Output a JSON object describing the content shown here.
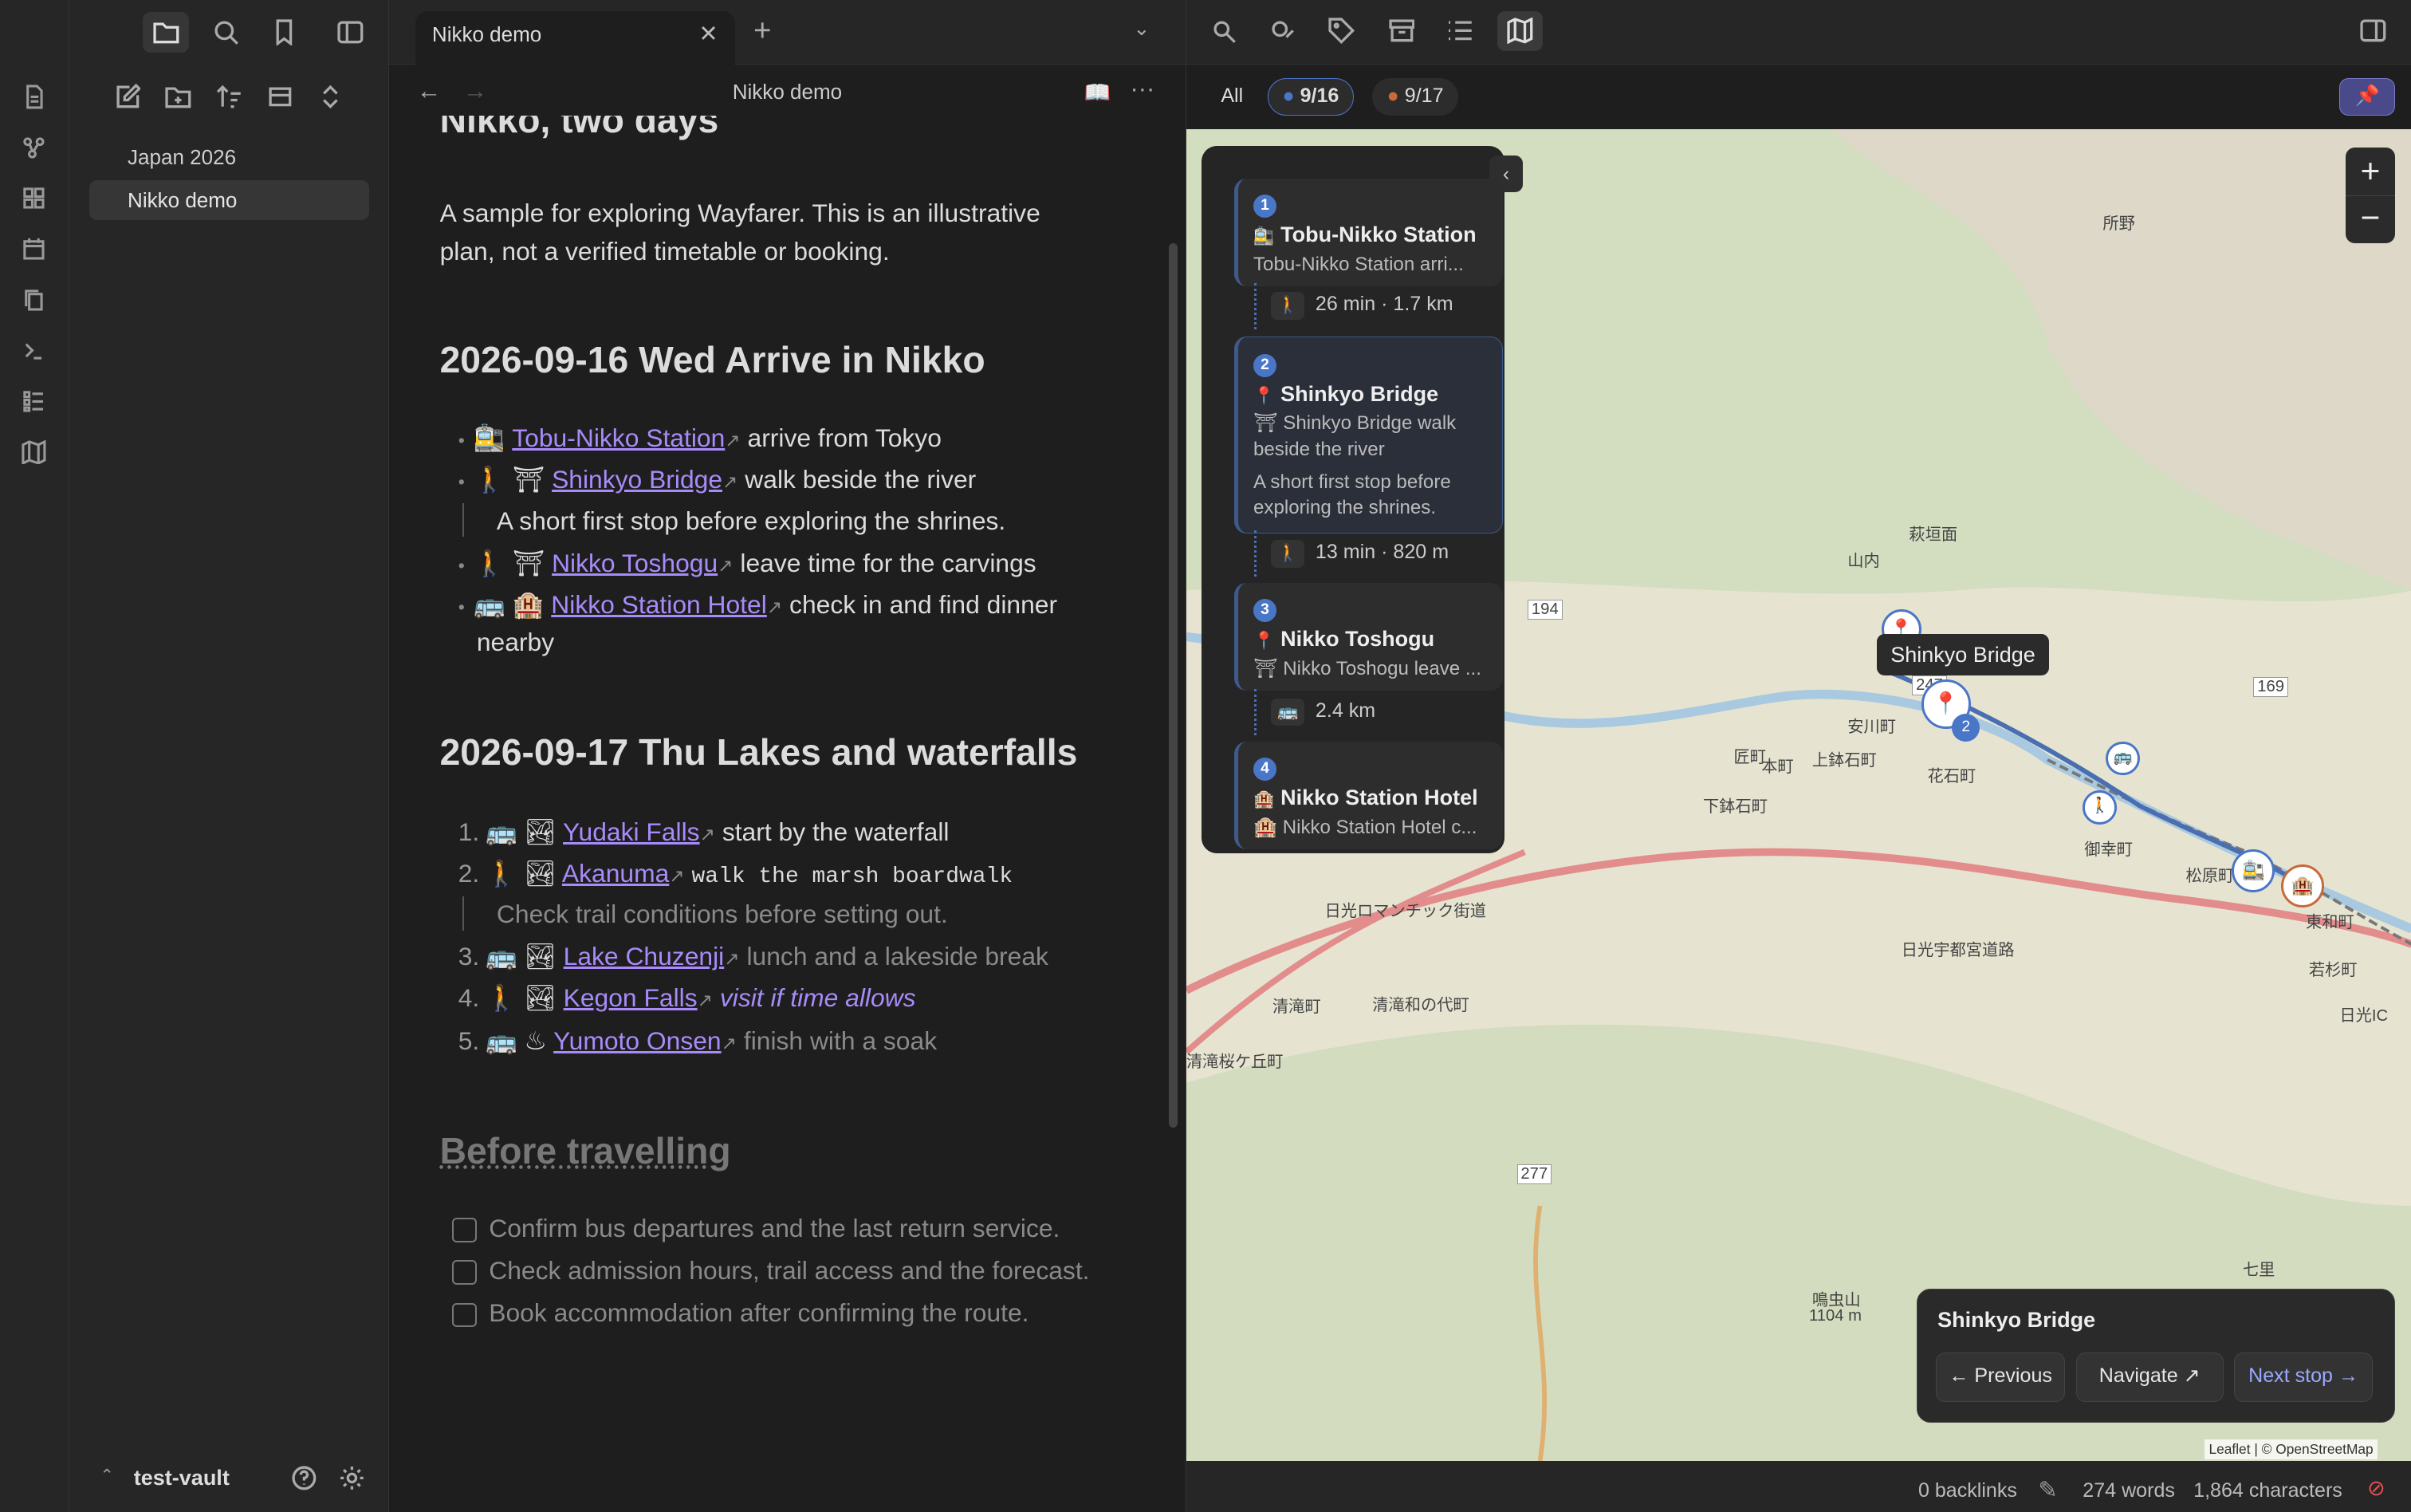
{
  "ribbon": {
    "icons": [
      "file-icon",
      "graph-icon",
      "grid-icon",
      "calendar-icon",
      "copy-icon",
      "terminal-icon",
      "list-icon",
      "map-icon"
    ]
  },
  "sidebar": {
    "items": [
      {
        "label": "Japan 2026"
      },
      {
        "label": "Nikko demo"
      }
    ],
    "vault": "test-vault"
  },
  "editor": {
    "tab_title": "Nikko demo",
    "view_title": "Nikko demo",
    "h1_partial": "Nikko, two days",
    "intro": [
      "A sample for exploring Wayfarer. This is an illustrative",
      "plan, not a verified timetable or booking."
    ],
    "day1": {
      "heading": "2026-09-16 Wed Arrive in Nikko",
      "items": [
        {
          "emoji": "🚉",
          "link": "Tobu-Nikko Station",
          "text": "arrive from Tokyo"
        },
        {
          "emoji": "🚶 ⛩",
          "link": "Shinkyo Bridge",
          "text": "walk beside the river"
        },
        {
          "note": "A short first stop before exploring the shrines."
        },
        {
          "emoji": "🚶 ⛩",
          "link": "Nikko Toshogu",
          "text": "leave time for the carvings"
        },
        {
          "emoji": "🚌 🏨",
          "link": "Nikko Station Hotel",
          "text": "check in and find dinner"
        },
        {
          "cont": "nearby"
        }
      ]
    },
    "day2": {
      "heading": "2026-09-17 Thu Lakes and waterfalls",
      "items": [
        {
          "n": "1.",
          "emoji": "🚌 🏞",
          "link": "Yudaki Falls",
          "text": "start by the waterfall"
        },
        {
          "n": "2.",
          "emoji": "🚶 🏞",
          "link": "Akanuma",
          "text": "walk the marsh boardwalk"
        },
        {
          "note": "Check trail conditions before setting out."
        },
        {
          "n": "3.",
          "emoji": "🚌 🏞",
          "link": "Lake Chuzenji",
          "text": "lunch and a lakeside break"
        },
        {
          "n": "4.",
          "emoji": "🚶 🏞",
          "link": "Kegon Falls",
          "text": "visit if time allows"
        },
        {
          "n": "5.",
          "emoji": "🚌 ♨",
          "link": "Yumoto Onsen",
          "text": "finish with a soak"
        }
      ]
    },
    "before": {
      "heading": "Before travelling",
      "tasks": [
        "Confirm bus departures and the last return service.",
        "Check admission hours, trail access and the forecast.",
        "Book accommodation after confirming the route."
      ]
    }
  },
  "map": {
    "filters": [
      "All",
      "9/16",
      "9/17"
    ],
    "stops": [
      {
        "n": "1",
        "title": "Tobu-Nikko Station",
        "emoji": "🚉",
        "sub": "Tobu-Nikko Station arri..."
      },
      {
        "n": "2",
        "title": "Shinkyo Bridge",
        "emoji": "📍",
        "sub": "⛩ Shinkyo Bridge walk beside the river",
        "note": "A short first stop before exploring the shrines."
      },
      {
        "n": "3",
        "title": "Nikko Toshogu",
        "emoji": "📍",
        "sub": "⛩ Nikko Toshogu leave ..."
      },
      {
        "n": "4",
        "title": "Nikko Station Hotel",
        "emoji": "🏨",
        "sub": "🏨 Nikko Station Hotel c..."
      }
    ],
    "segments": [
      {
        "icon": "🚶",
        "text": "26 min · 1.7 km"
      },
      {
        "icon": "🚶",
        "text": "13 min · 820 m"
      },
      {
        "icon": "🚌",
        "text": "2.4 km"
      }
    ],
    "tooltip": "Shinkyo Bridge",
    "popup": {
      "title": "Shinkyo Bridge",
      "prev": "← Previous",
      "nav": "Navigate ↗",
      "next": "Next stop →"
    },
    "attribution": "Leaflet | © OpenStreetMap",
    "labels": [
      "所野",
      "萩垣面",
      "山内",
      "安川町",
      "本町",
      "上鉢石町",
      "花石町",
      "匠町",
      "下鉢石町",
      "御幸町",
      "松原町",
      "東和町",
      "若杉町",
      "清滝町",
      "清滝和の代町",
      "清滝桜ケ丘町",
      "七里",
      "鳴虫山",
      "1104 m",
      "日光宇都宮道路",
      "日光ロマンチック街道",
      "194",
      "247",
      "169",
      "277",
      "日光IC"
    ]
  },
  "status": {
    "backlinks": "0 backlinks",
    "words": "274 words",
    "chars": "1,864 characters"
  }
}
